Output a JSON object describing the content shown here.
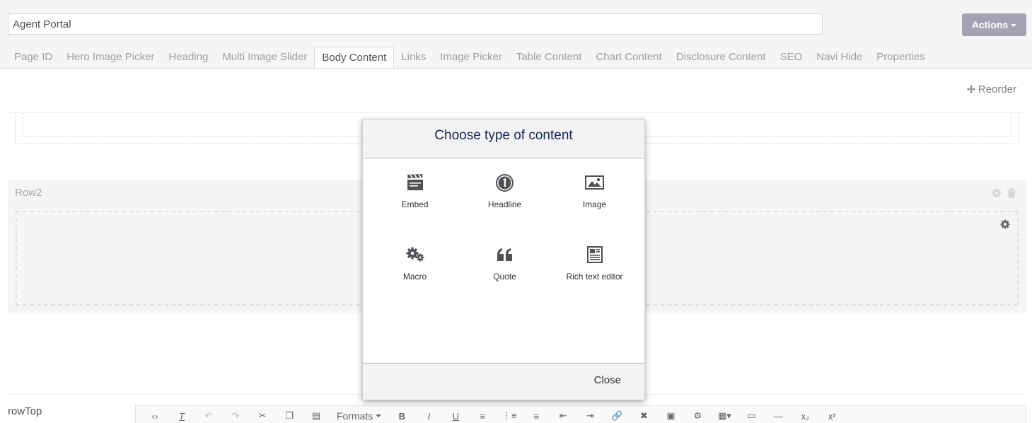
{
  "document": {
    "name": "Agent Portal"
  },
  "header": {
    "actions_label": "Actions"
  },
  "tabs": [
    {
      "label": "Page ID",
      "active": false
    },
    {
      "label": "Hero Image Picker",
      "active": false
    },
    {
      "label": "Heading",
      "active": false
    },
    {
      "label": "Multi Image Slider",
      "active": false
    },
    {
      "label": "Body Content",
      "active": true
    },
    {
      "label": "Links",
      "active": false
    },
    {
      "label": "Image Picker",
      "active": false
    },
    {
      "label": "Table Content",
      "active": false
    },
    {
      "label": "Chart Content",
      "active": false
    },
    {
      "label": "Disclosure Content",
      "active": false
    },
    {
      "label": "SEO",
      "active": false
    },
    {
      "label": "Navi Hide",
      "active": false
    },
    {
      "label": "Properties",
      "active": false
    }
  ],
  "grid": {
    "reorder_label": "Reorder",
    "row2_label": "Row2",
    "row_top_label": "rowTop"
  },
  "editor_toolbar": {
    "formats_label": "Formats",
    "bold_label": "B",
    "italic_label": "I",
    "underline_label": "U"
  },
  "modal": {
    "title": "Choose type of content",
    "close_label": "Close",
    "items": [
      {
        "label": "Embed",
        "icon": "clapperboard-icon"
      },
      {
        "label": "Headline",
        "icon": "circled-one-icon"
      },
      {
        "label": "Image",
        "icon": "picture-icon"
      },
      {
        "label": "Macro",
        "icon": "gears-icon"
      },
      {
        "label": "Quote",
        "icon": "quote-icon"
      },
      {
        "label": "Rich text editor",
        "icon": "newspaper-icon"
      }
    ]
  },
  "colors": {
    "actions_bg": "#a6a1b3",
    "text_primary": "#1b264f",
    "icon_dark": "#515054"
  }
}
